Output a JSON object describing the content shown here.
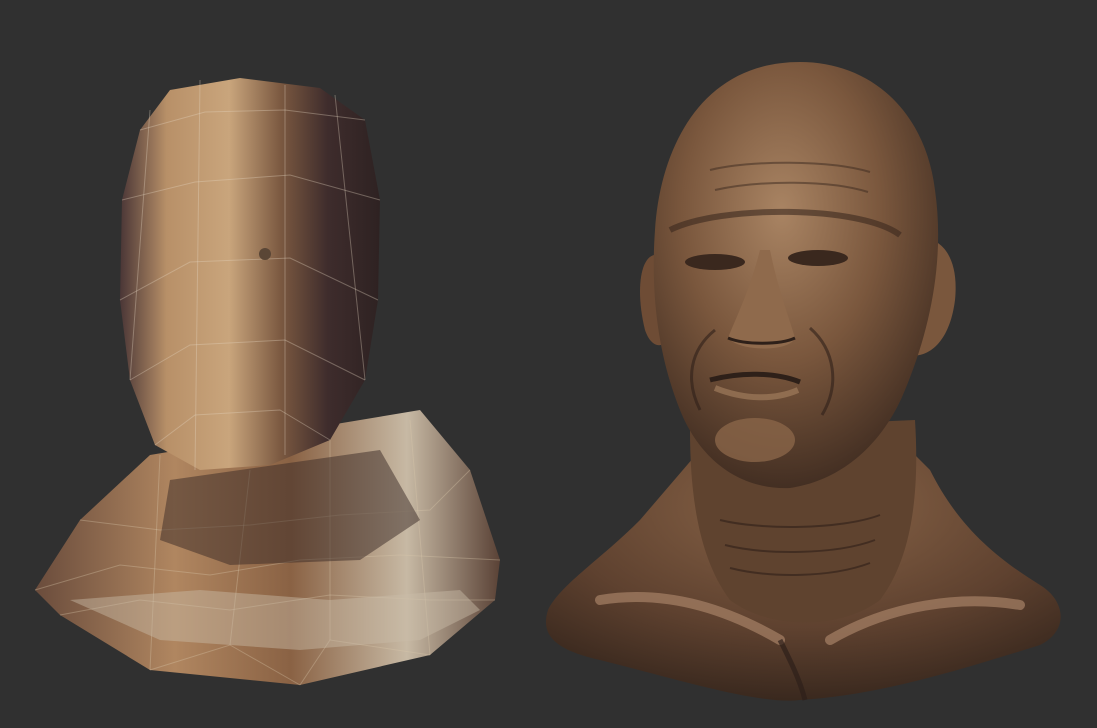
{
  "scene": {
    "background_color": "#303030",
    "models": [
      {
        "id": "lowpoly-head-bust",
        "style": "low-poly base mesh",
        "material_colors": {
          "light": "#c9a57c",
          "mid": "#9a6f47",
          "dark": "#3a2a2a",
          "highlight": "#d8d2c4"
        }
      },
      {
        "id": "sculpted-head-bust",
        "style": "high-detail sculpt",
        "material_colors": {
          "light": "#a98463",
          "mid": "#6e4c35",
          "dark": "#2e2019"
        }
      }
    ]
  }
}
